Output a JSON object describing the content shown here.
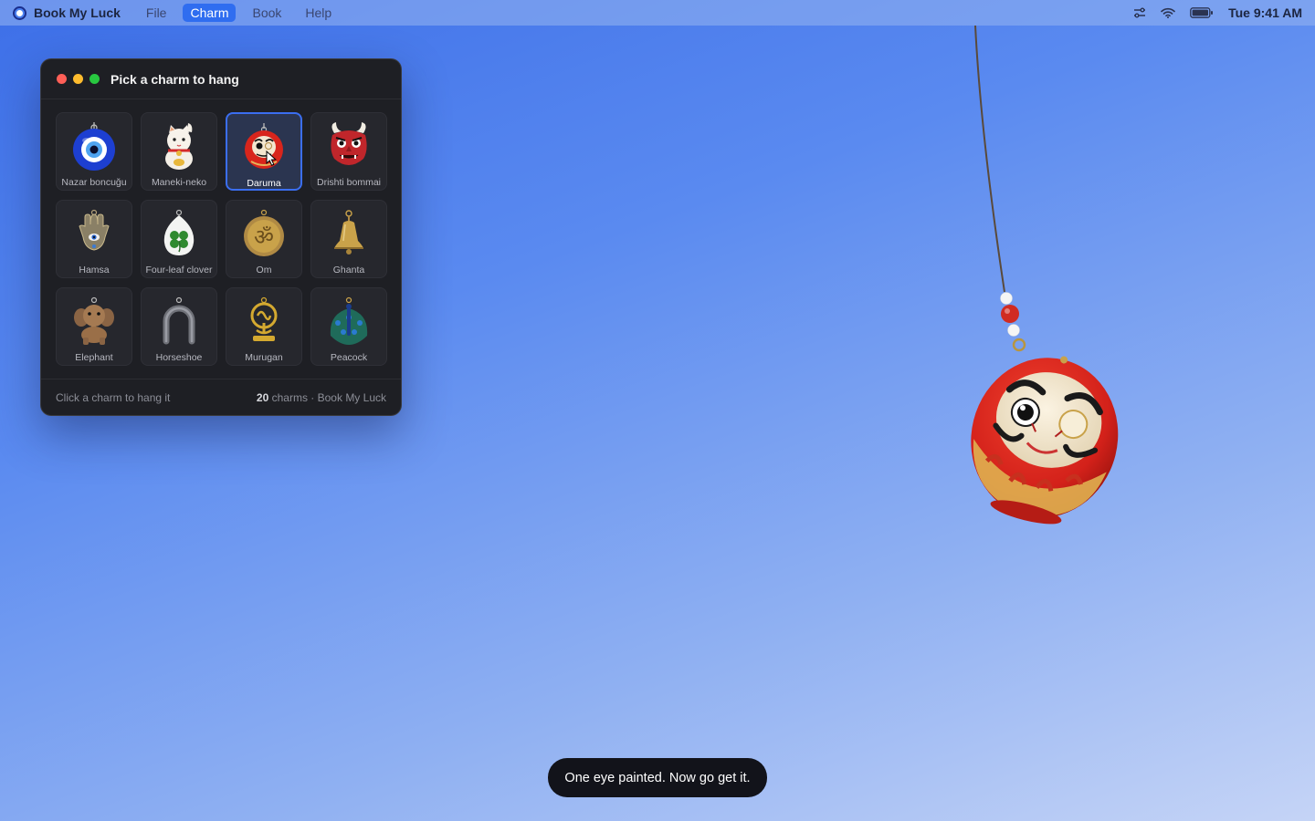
{
  "menubar": {
    "app_name": "Book My Luck",
    "menus": [
      "File",
      "Charm",
      "Book",
      "Help"
    ],
    "active_menu": "Charm",
    "clock": "Tue 9:41 AM"
  },
  "window": {
    "title": "Pick a charm to hang",
    "charms": [
      {
        "label": "Nazar boncuğu",
        "icon": "evil-eye-icon"
      },
      {
        "label": "Maneki-neko",
        "icon": "lucky-cat-icon"
      },
      {
        "label": "Daruma",
        "icon": "daruma-doll-icon",
        "selected": true
      },
      {
        "label": "Drishti bommai",
        "icon": "demon-mask-icon"
      },
      {
        "label": "Hamsa",
        "icon": "hamsa-hand-icon"
      },
      {
        "label": "Four-leaf clover",
        "icon": "clover-icon"
      },
      {
        "label": "Om",
        "icon": "om-symbol-icon"
      },
      {
        "label": "Ghanta",
        "icon": "bell-icon"
      },
      {
        "label": "Elephant",
        "icon": "elephant-icon"
      },
      {
        "label": "Horseshoe",
        "icon": "horseshoe-icon"
      },
      {
        "label": "Murugan",
        "icon": "murugan-pendant-icon"
      },
      {
        "label": "Peacock",
        "icon": "peacock-icon"
      }
    ],
    "footer_hint": "Click a charm to hang it",
    "footer_count": "20",
    "footer_suffix": "charms · Book My Luck"
  },
  "toast": "One eye painted. Now go get it.",
  "colors": {
    "accent": "#3b6ef0",
    "window_bg": "#1e1f24",
    "daruma_red": "#d8251c",
    "gold": "#c9a24a"
  }
}
